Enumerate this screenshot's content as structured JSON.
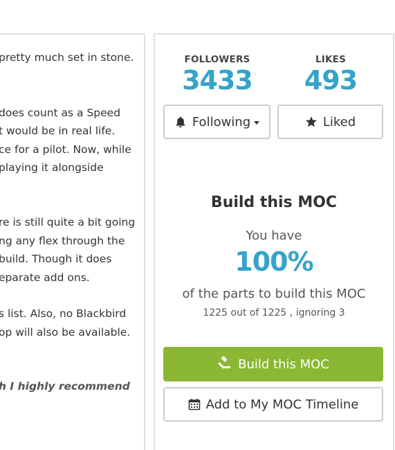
{
  "description": {
    "lines": [
      "pretty much set in stone.",
      "does count as a Speed",
      "t would be in real life.",
      "ce for a pilot. Now, while",
      "playing it alongside",
      "re is still quite a bit going",
      "ng any flex through the",
      " build. Though it does",
      "eparate add ons.",
      "s list. Also, no Blackbird",
      "op will also be available.",
      "h I highly recommend"
    ]
  },
  "stats": {
    "followers_label": "FOLLOWERS",
    "followers_value": "3433",
    "likes_label": "LIKES",
    "likes_value": "493"
  },
  "actions": {
    "following_label": "Following",
    "liked_label": "Liked"
  },
  "build": {
    "title": "Build this MOC",
    "you_have": "You have",
    "percent": "100%",
    "parts_text": "of the parts to build this MOC",
    "parts_count": "1225 out of 1225 , ignoring 3",
    "build_button": "Build this MOC",
    "timeline_button": "Add to My MOC Timeline"
  },
  "colors": {
    "accent_blue": "#36a3c9",
    "build_green": "#8ab834"
  },
  "icons": {
    "following": "bell-icon",
    "liked": "star-icon",
    "build": "gavel-icon",
    "timeline": "calendar-icon"
  }
}
